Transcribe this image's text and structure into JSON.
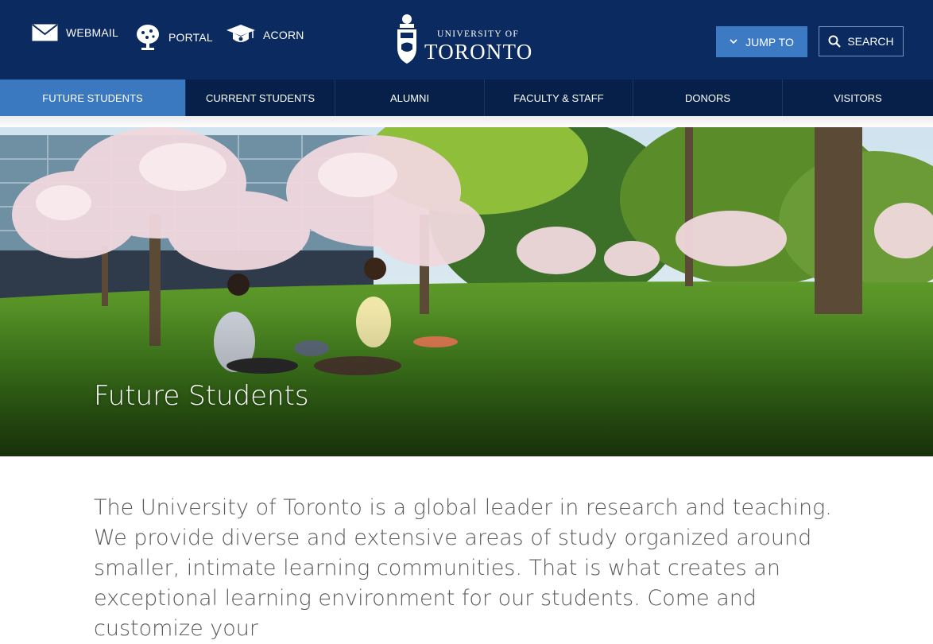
{
  "header": {
    "utility_links": [
      {
        "label": "WEBMAIL",
        "icon": "envelope-icon"
      },
      {
        "label": "PORTAL",
        "icon": "tree-icon"
      },
      {
        "label": "ACORN",
        "icon": "graduation-cap-icon"
      }
    ],
    "logo": {
      "line1": "UNIVERSITY OF",
      "line2": "TORONTO"
    },
    "jump_to_label": "JUMP TO",
    "search_label": "SEARCH"
  },
  "nav": {
    "items": [
      {
        "label": "FUTURE STUDENTS",
        "active": true
      },
      {
        "label": "CURRENT STUDENTS",
        "active": false
      },
      {
        "label": "ALUMNI",
        "active": false
      },
      {
        "label": "FACULTY & STAFF",
        "active": false
      },
      {
        "label": "DONORS",
        "active": false
      },
      {
        "label": "VISITORS",
        "active": false
      }
    ]
  },
  "hero": {
    "title": "Future Students"
  },
  "intro": {
    "text": "The University of Toronto is a global leader in research and teaching. We provide diverse and extensive areas of study organized around smaller, intimate learning communities. That is what creates an exceptional learning environment for our students. Come and customize your"
  },
  "colors": {
    "header_bg": "#0b2a5f",
    "nav_bg": "#06204a",
    "accent": "#3a78c0"
  }
}
